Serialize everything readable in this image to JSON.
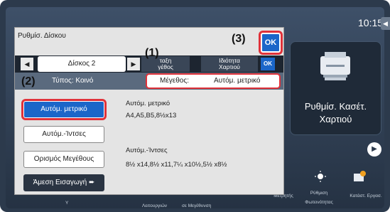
{
  "clock": "10:15",
  "dialog": {
    "title": "Ρυθμίσ. Δίσκου",
    "ok_label": "OK",
    "tabs": {
      "disk_label": "Δίσκος 2",
      "size_tab": "Μέγεθος",
      "size_tab_partial": "ταξη\nγέθος",
      "property_tab": "Ιδιότητα\nΧαρτιού",
      "small_ok": "OK",
      "prev_arrow": "◀",
      "next_arrow": "▶"
    },
    "type_label": "Τύπος:  Κοινό",
    "size_field": {
      "key": "Μέγεθος:",
      "value": "Αυτόμ. μετρικό"
    },
    "options": [
      {
        "label": "Αυτόμ. μετρικό",
        "selected": true
      },
      {
        "label": "Αυτόμ.-Ίντσες",
        "selected": false
      },
      {
        "label": "Ορισμός Μεγέθους",
        "selected": false
      },
      {
        "label": "Άμεση Εισαγωγή",
        "selected": false
      }
    ],
    "descriptions": {
      "metric_title": "Αυτόμ. μετρικό",
      "metric_sizes": "A4,A5,B5,8½x13",
      "inch_title": "Αυτόμ.-Ίντσες",
      "inch_sizes": "8½ x14,8½ x11,7¼ x10½,5½ x8½"
    }
  },
  "tile": {
    "label": "Ρυθμίσ. Κασέτ.\nΧαρτιού"
  },
  "bottom": {
    "icon1_label": "Μετρητής",
    "icon2_label": "Ρύθμιση\nΦωτεινότητας",
    "icon3_label": "Κατάστ. Εργασ.",
    "text_left": "Λειτουργιών",
    "text_mid": "σε Μεγέθυνση",
    "text_y": "Y"
  },
  "callouts": {
    "c1": "(1)",
    "c2": "(2)",
    "c3": "(3)"
  },
  "colors": {
    "accent": "#1b66c9",
    "highlight": "#e0323a",
    "panel": "#2c3a4c"
  }
}
